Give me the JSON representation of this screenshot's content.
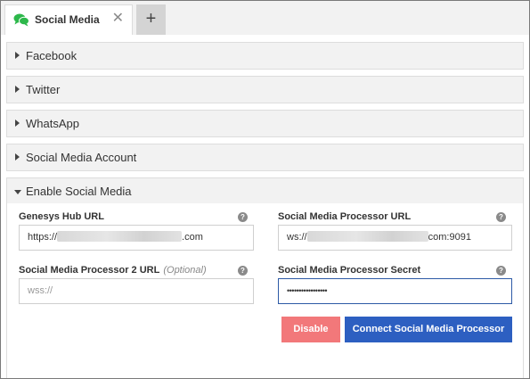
{
  "tabs": [
    {
      "label": "Social Media",
      "icon": "chat-bubbles-icon",
      "close": "✕"
    }
  ],
  "add_tab": "+",
  "sections": [
    {
      "label": "Facebook",
      "expanded": false
    },
    {
      "label": "Twitter",
      "expanded": false
    },
    {
      "label": "WhatsApp",
      "expanded": false
    },
    {
      "label": "Social Media Account",
      "expanded": false
    },
    {
      "label": "Enable Social Media",
      "expanded": true
    }
  ],
  "form": {
    "hub_url": {
      "label": "Genesys Hub URL",
      "prefix": "https://",
      "suffix": ".com"
    },
    "processor_url": {
      "label": "Social Media Processor URL",
      "prefix": "ws://",
      "suffix": "com:9091"
    },
    "processor2_url": {
      "label": "Social Media Processor 2 URL",
      "optional": "(Optional)",
      "placeholder": "wss://"
    },
    "processor_secret": {
      "label": "Social Media Processor Secret",
      "value": "•••••••••••••••••"
    },
    "help_glyph": "?"
  },
  "buttons": {
    "disable": "Disable",
    "connect": "Connect Social Media Processor"
  },
  "colors": {
    "tab_icon": "#2db84b",
    "disable_button": "#f2787a",
    "connect_button": "#2d5fc1",
    "focus_border": "#2d5aa6"
  }
}
